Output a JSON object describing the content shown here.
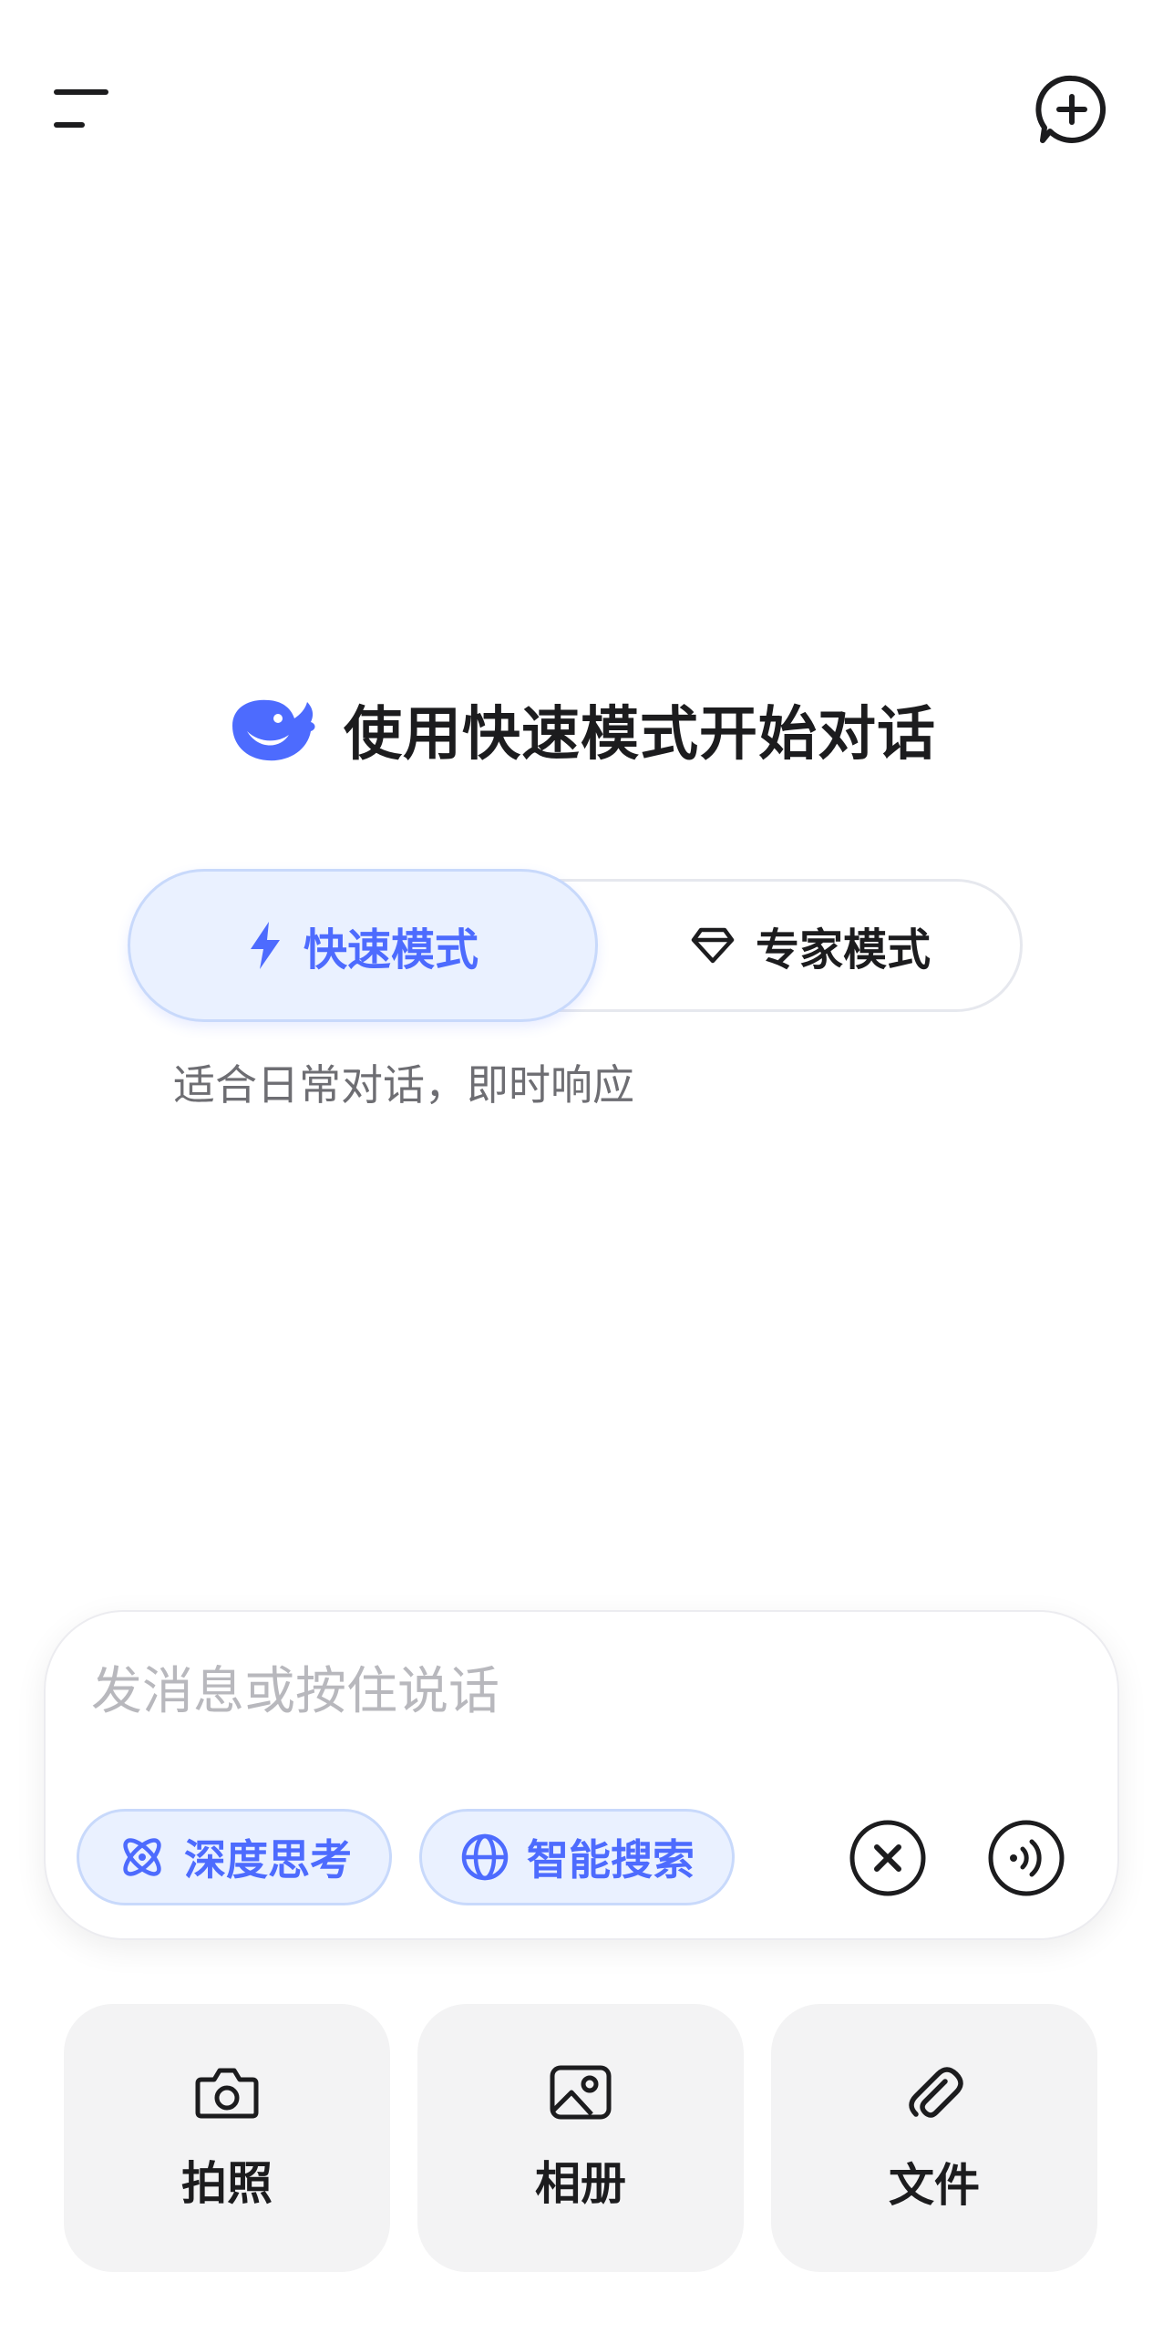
{
  "colors": {
    "accent": "#4d6bfe",
    "accent_bg": "#eaf1ff",
    "text_primary": "#1c1c1e",
    "text_secondary": "#6e6e73",
    "placeholder": "#b8b8bd",
    "tile_bg": "#f3f3f4"
  },
  "header": {
    "menu_icon": "menu-icon",
    "new_chat_icon": "new-chat-icon"
  },
  "greeting": {
    "logo_icon": "whale-logo-icon",
    "text": "使用快速模式开始对话"
  },
  "modes": {
    "selected": "fast",
    "fast": {
      "label": "快速模式",
      "icon": "lightning-icon"
    },
    "expert": {
      "label": "专家模式",
      "icon": "diamond-icon"
    },
    "description": "适合日常对话，即时响应"
  },
  "composer": {
    "placeholder": "发消息或按住说话",
    "value": "",
    "chips": [
      {
        "label": "深度思考",
        "icon": "atom-icon"
      },
      {
        "label": "智能搜索",
        "icon": "globe-icon"
      }
    ],
    "clear_icon": "close-circle-icon",
    "voice_icon": "voice-wave-icon"
  },
  "actions": [
    {
      "label": "拍照",
      "icon": "camera-icon"
    },
    {
      "label": "相册",
      "icon": "image-icon"
    },
    {
      "label": "文件",
      "icon": "paperclip-icon"
    }
  ]
}
